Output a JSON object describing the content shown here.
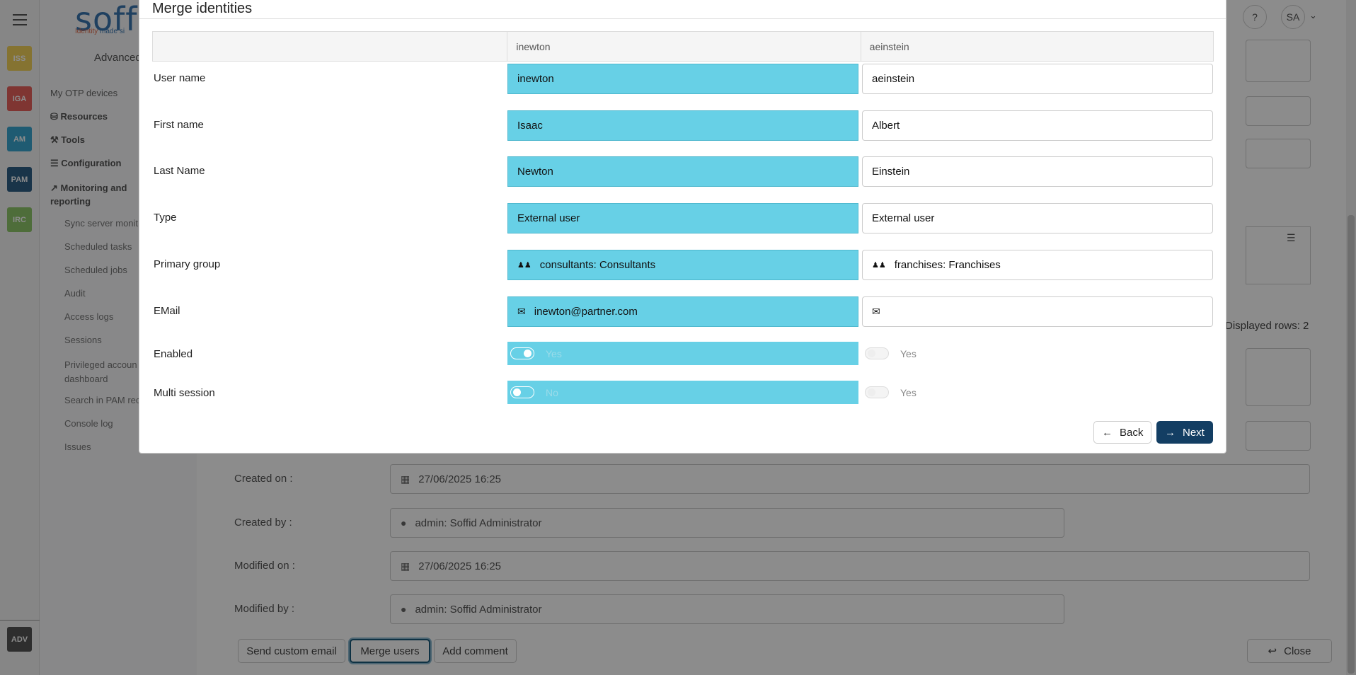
{
  "rail": {
    "apps": [
      {
        "code": "ISS",
        "color": "#f3d25a"
      },
      {
        "code": "IGA",
        "color": "#e8625c"
      },
      {
        "code": "AM",
        "color": "#3aa7d0"
      },
      {
        "code": "PAM",
        "color": "#2f5f86"
      },
      {
        "code": "IRC",
        "color": "#8ec66b"
      }
    ],
    "bottom_app": {
      "code": "ADV",
      "color": "#555555"
    }
  },
  "sidebar": {
    "logo": "soffi",
    "logo_tagline_1": "Identity",
    "logo_tagline_2": "made si",
    "section": "Advanced",
    "items": [
      {
        "label": "My OTP devices",
        "level": "top"
      },
      {
        "label": "Resources",
        "level": "bold"
      },
      {
        "label": "Tools",
        "level": "bold"
      },
      {
        "label": "Configuration",
        "level": "bold"
      },
      {
        "label": "Monitoring and reporting",
        "level": "bold"
      }
    ],
    "sub_items": [
      "Sync server monit",
      "Scheduled tasks",
      "Scheduled jobs",
      "Audit",
      "Access logs",
      "Sessions",
      "Privileged accoun dashboard",
      "Search in PAM rec",
      "Console log",
      "Issues"
    ]
  },
  "header": {
    "help": "?",
    "user_initials": "SA"
  },
  "background": {
    "displayed_rows": "Displayed rows: 2",
    "rows": [
      {
        "label": "Created on :",
        "value": "27/06/2025 16:25",
        "icon": "calendar-icon"
      },
      {
        "label": "Created by :",
        "value": "admin: Soffid Administrator",
        "icon": "user-icon"
      },
      {
        "label": "Modified on :",
        "value": "27/06/2025 16:25",
        "icon": "calendar-icon"
      },
      {
        "label": "Modified by :",
        "value": "admin: Soffid Administrator",
        "icon": "user-icon"
      }
    ],
    "buttons": {
      "send_custom_email": "Send custom email",
      "merge_users": "Merge users",
      "add_comment": "Add comment",
      "close": "Close"
    }
  },
  "modal": {
    "title": "Merge identities",
    "columns": [
      "",
      "inewton",
      "aeinstein"
    ],
    "fields": [
      {
        "label": "User name",
        "left": "inewton",
        "right": "aeinstein",
        "icon": ""
      },
      {
        "label": "First name",
        "left": "Isaac",
        "right": "Albert",
        "icon": ""
      },
      {
        "label": "Last Name",
        "left": "Newton",
        "right": "Einstein",
        "icon": ""
      },
      {
        "label": "Type",
        "left": "External user",
        "right": "External user",
        "icon": ""
      },
      {
        "label": "Primary group",
        "left": "consultants: Consultants",
        "right": "franchises: Franchises",
        "icon": "group-icon"
      },
      {
        "label": "EMail",
        "left": "inewton@partner.com",
        "right": "",
        "icon": "mail-icon"
      }
    ],
    "toggles": [
      {
        "label": "Enabled",
        "left_state": "on",
        "left_text": "Yes",
        "right_text": "Yes"
      },
      {
        "label": "Multi session",
        "left_state": "off",
        "left_text": "No",
        "right_text": "Yes"
      }
    ],
    "back_label": "Back",
    "next_label": "Next"
  },
  "colors": {
    "selected_cell": "#67d0e6",
    "primary_button": "#133e63"
  }
}
